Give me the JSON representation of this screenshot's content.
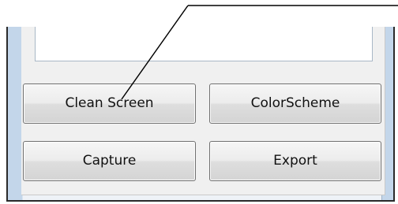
{
  "buttons": {
    "clean_screen": "Clean Screen",
    "color_scheme": "ColorScheme",
    "capture": "Capture",
    "export": "Export"
  },
  "colors": {
    "frame_accent": "#c3d6ea",
    "panel_background": "#f0f0f0",
    "button_border": "#707070",
    "callout_line": "#000000"
  },
  "annotation": {
    "type": "callout-leader-line",
    "target": "clean_screen"
  }
}
